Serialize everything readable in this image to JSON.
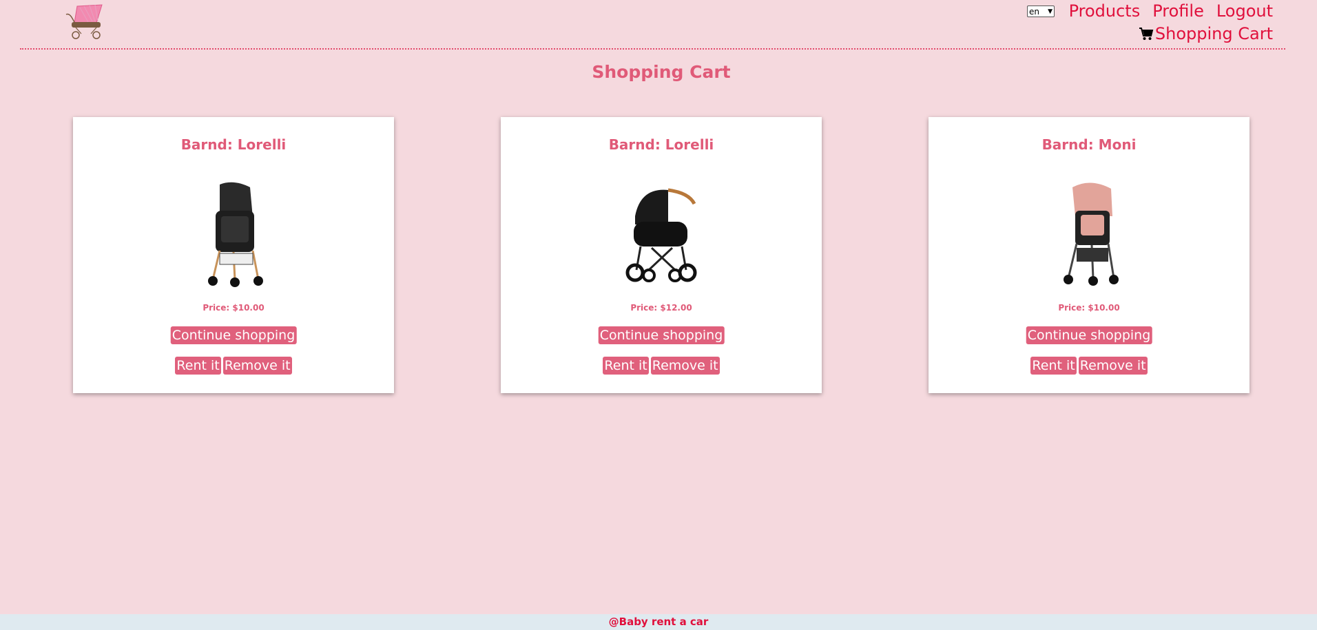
{
  "header": {
    "language": "en",
    "nav": {
      "products": "Products",
      "profile": "Profile",
      "logout": "Logout",
      "cart": "Shopping Cart"
    }
  },
  "page_title": "Shopping Cart",
  "cards": [
    {
      "brand": "Barnd: Lorelli",
      "price": "Price: $10.00",
      "continue": "Continue shopping",
      "rent": "Rent it",
      "remove": "Remove it"
    },
    {
      "brand": "Barnd: Lorelli",
      "price": "Price: $12.00",
      "continue": "Continue shopping",
      "rent": "Rent it",
      "remove": "Remove it"
    },
    {
      "brand": "Barnd: Moni",
      "price": "Price: $10.00",
      "continue": "Continue shopping",
      "rent": "Rent it",
      "remove": "Remove it"
    }
  ],
  "footer": "@Baby rent a car",
  "colors": {
    "background": "#f5d9de",
    "accent": "#e0103c",
    "button": "#e0607c",
    "title": "#e05a78",
    "footer_bg": "#dfeaf0"
  }
}
